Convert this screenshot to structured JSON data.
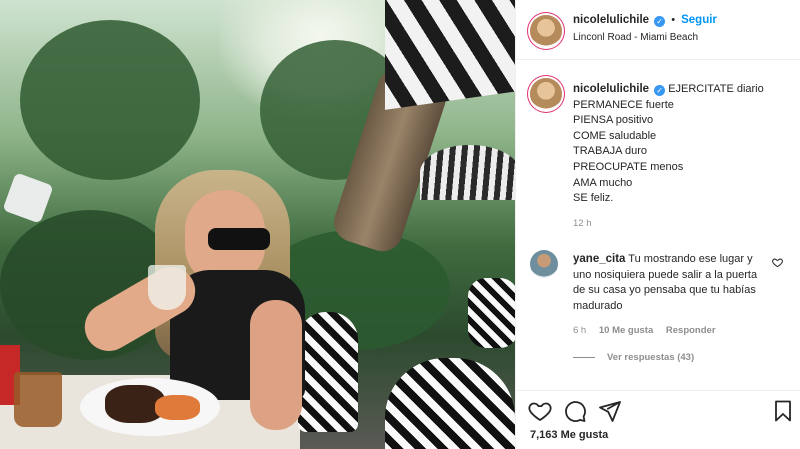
{
  "post": {
    "username": "nicolelulichile",
    "follow_label": "Seguir",
    "location": "Linconl Road - Miami Beach",
    "caption": {
      "username": "nicolelulichile",
      "lines": [
        "EJERCITATE diario",
        "PERMANECE fuerte",
        "PIENSA positivo",
        "COME saludable",
        "TRABAJA duro",
        "PREOCUPATE menos",
        "AMA mucho",
        "SE feliz."
      ],
      "time": "12 h"
    },
    "comment": {
      "username": "yane_cita",
      "text": "Tu mostrando ese lugar y uno nosiquiera puede salir a la puerta de su casa yo pensaba que tu habías madurado",
      "time": "6 h",
      "likes": "10 Me gusta",
      "reply_label": "Responder",
      "view_replies": "Ver respuestas (43)"
    },
    "likes_label": "7,163 Me gusta"
  },
  "icons": {
    "verified": "verified-badge-icon",
    "more": "more-options-icon",
    "like": "heart-icon",
    "comment": "comment-icon",
    "share": "share-icon",
    "save": "bookmark-icon"
  },
  "colors": {
    "accent": "#0095f6",
    "verified": "#3897f0",
    "muted": "#8e8e8e",
    "text": "#262626"
  }
}
